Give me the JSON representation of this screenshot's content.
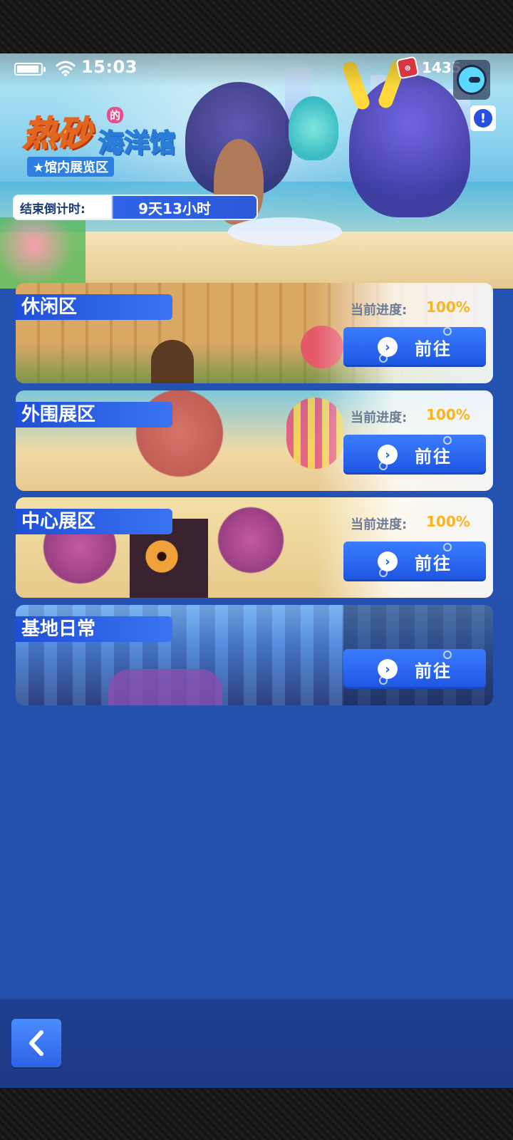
{
  "status_bar": {
    "time": "15:03"
  },
  "currency": {
    "value": "1435",
    "icon": "ticket-icon"
  },
  "event": {
    "title_main": "热砂",
    "title_particle": "的",
    "title_sub": "海洋馆",
    "tag": "★馆内展览区",
    "countdown_label": "结束倒计时:",
    "countdown_value": "9天13小时"
  },
  "zones": [
    {
      "name": "休闲区",
      "progress_label": "当前进度:",
      "progress_value": "100%",
      "button_label": "前往",
      "theme": "#d8a860"
    },
    {
      "name": "外围展区",
      "progress_label": "当前进度:",
      "progress_value": "100%",
      "button_label": "前往",
      "theme": "#c96a5e"
    },
    {
      "name": "中心展区",
      "progress_label": "当前进度:",
      "progress_value": "100%",
      "button_label": "前往",
      "theme": "#8a5a7a"
    },
    {
      "name": "基地日常",
      "progress_label": "",
      "progress_value": "",
      "button_label": "前往",
      "theme": "#3a6ec8"
    }
  ],
  "colors": {
    "background": "#2553b2",
    "button": "#2d63e6",
    "progress": "#ffb31a"
  }
}
